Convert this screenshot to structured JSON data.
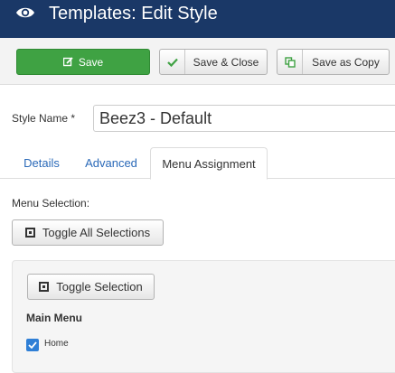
{
  "header": {
    "title": "Templates: Edit Style",
    "icon": "eye-icon"
  },
  "toolbar": {
    "save_label": "Save",
    "save_close_label": "Save & Close",
    "save_copy_label": "Save as Copy",
    "save_color": "#3fa243"
  },
  "form": {
    "style_name_label": "Style Name *",
    "style_name_value": "Beez3 - Default"
  },
  "tabs": [
    {
      "label": "Details",
      "active": false
    },
    {
      "label": "Advanced",
      "active": false
    },
    {
      "label": "Menu Assignment",
      "active": true
    }
  ],
  "menu_assignment": {
    "menu_selection_label": "Menu Selection:",
    "toggle_all_label": "Toggle All Selections",
    "toggle_selection_label": "Toggle Selection",
    "menu_title": "Main Menu",
    "items": [
      {
        "label": "Home",
        "checked": true
      }
    ]
  },
  "colors": {
    "header_bg": "#1a3867",
    "link": "#2a69b8",
    "checkbox": "#2f7fd6"
  }
}
